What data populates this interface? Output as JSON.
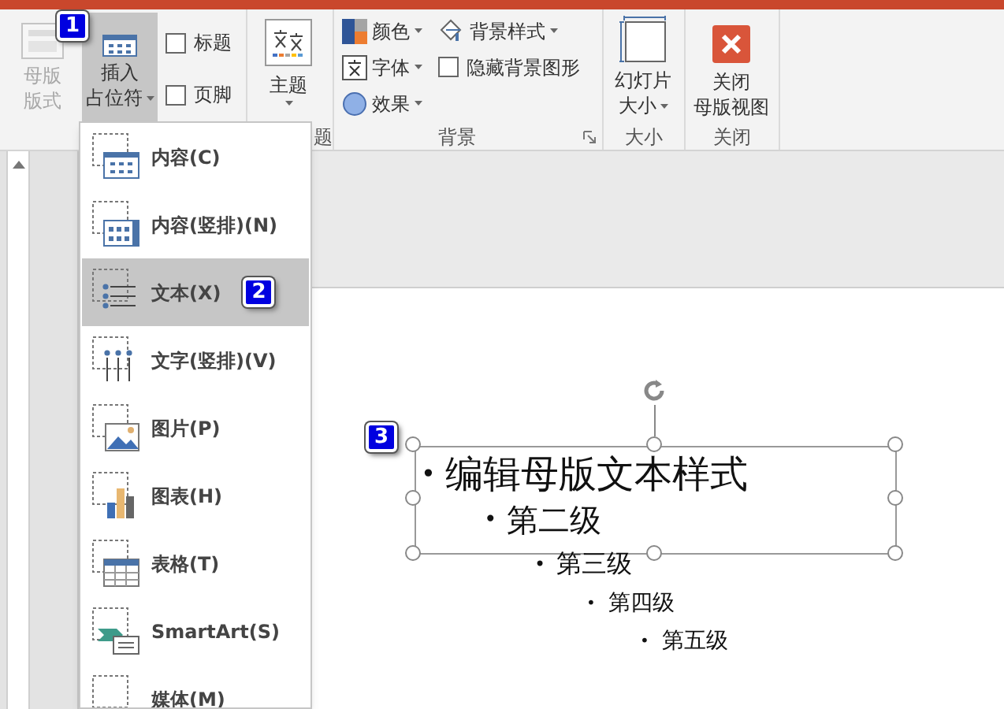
{
  "ribbon": {
    "master_layout_button": {
      "label_lines": [
        "母版",
        "版式"
      ],
      "disabled": true
    },
    "insert_placeholder_button": {
      "label_lines": [
        "插入",
        "占位符"
      ],
      "pressed": true,
      "callout": "1"
    },
    "checkboxes": [
      {
        "label": "标题",
        "checked": false
      },
      {
        "label": "页脚",
        "checked": false
      }
    ],
    "theme_button": {
      "label": "主题"
    },
    "theme_group_label": "题",
    "background_group": {
      "label": "背景",
      "items": [
        {
          "kind": "dropdown",
          "label": "颜色"
        },
        {
          "kind": "dropdown",
          "label": "字体"
        },
        {
          "kind": "dropdown",
          "label": "效果"
        },
        {
          "kind": "dropdown",
          "label": "背景样式"
        },
        {
          "kind": "checkbox",
          "label": "隐藏背景图形",
          "checked": false
        }
      ]
    },
    "size_group": {
      "button_lines": [
        "幻灯片",
        "大小"
      ],
      "label": "大小"
    },
    "close_group": {
      "button_lines": [
        "关闭",
        "母版视图"
      ],
      "label": "关闭"
    }
  },
  "placeholder_menu": {
    "items": [
      {
        "label": "内容(C)",
        "selected": false
      },
      {
        "label": "内容(竖排)(N)",
        "selected": false
      },
      {
        "label": "文本(X)",
        "selected": true,
        "callout": "2"
      },
      {
        "label": "文字(竖排)(V)",
        "selected": false
      },
      {
        "label": "图片(P)",
        "selected": false
      },
      {
        "label": "图表(H)",
        "selected": false
      },
      {
        "label": "表格(T)",
        "selected": false
      },
      {
        "label": "SmartArt(S)",
        "selected": false
      },
      {
        "label": "媒体(M)",
        "selected": false
      }
    ]
  },
  "slide": {
    "callout": "3",
    "outline": [
      {
        "bullet": "•",
        "text": "编辑母版文本样式",
        "children": [
          {
            "bullet": "•",
            "text": "第二级",
            "children": [
              {
                "bullet": "•",
                "text": "第三级",
                "children": [
                  {
                    "bullet": "•",
                    "text": "第四级",
                    "children": [
                      {
                        "bullet": "•",
                        "text": "第五级"
                      }
                    ]
                  }
                ]
              }
            ]
          }
        ]
      }
    ]
  }
}
